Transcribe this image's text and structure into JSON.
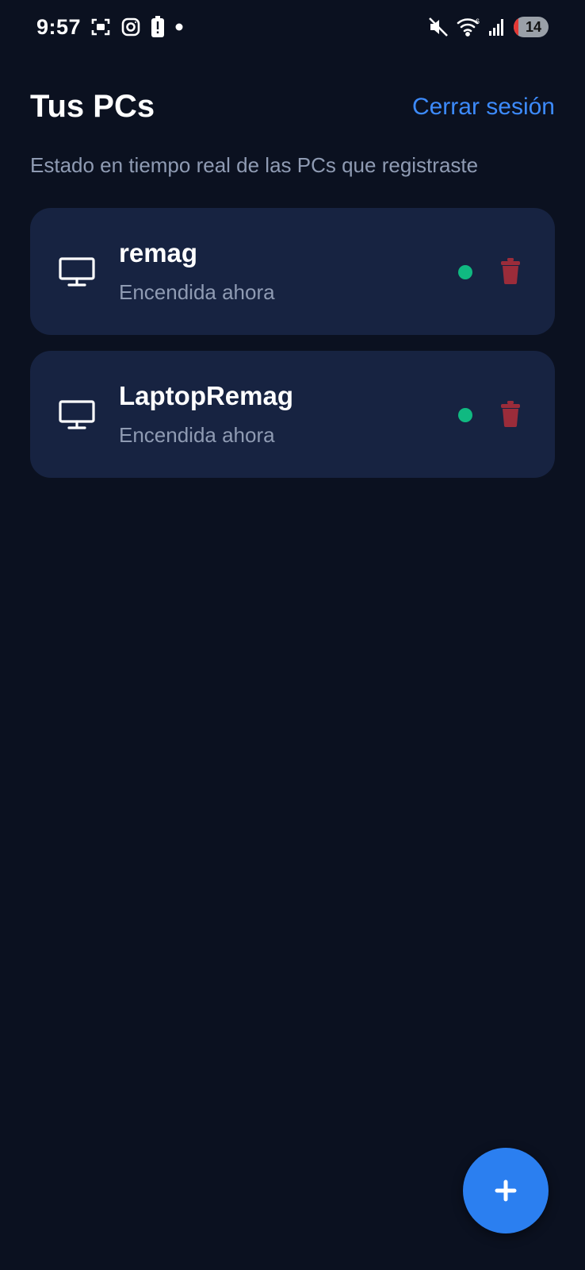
{
  "status_bar": {
    "time": "9:57",
    "battery_level": "14",
    "icons": [
      "screenshot-icon",
      "instagram-icon",
      "battery-alert-icon",
      "notification-dot-icon",
      "mute-icon",
      "wifi-icon",
      "signal-icon"
    ]
  },
  "header": {
    "title": "Tus PCs",
    "logout_label": "Cerrar sesión",
    "subtitle": "Estado en tiempo real de las PCs que registraste"
  },
  "pcs": [
    {
      "name": "remag",
      "status": "Encendida ahora",
      "online": true
    },
    {
      "name": "LaptopRemag",
      "status": "Encendida ahora",
      "online": true
    }
  ],
  "colors": {
    "background": "#0b1120",
    "card": "#172341",
    "accent": "#3d8bfd",
    "online": "#10b981",
    "delete": "#9b2c3a",
    "muted_text": "#8f9bb3"
  },
  "fab": {
    "icon": "plus-icon"
  }
}
